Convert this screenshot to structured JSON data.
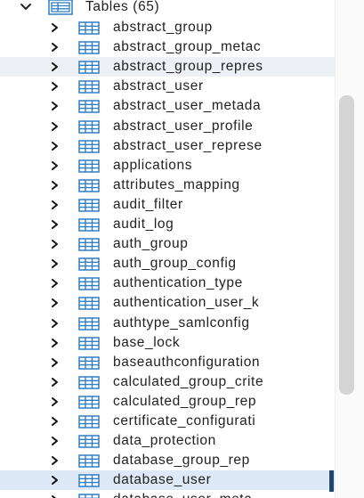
{
  "group": {
    "label": "Tables (65)",
    "expanded": true
  },
  "tables": [
    "abstract_group",
    "abstract_group_metac",
    "abstract_group_repres",
    "abstract_user",
    "abstract_user_metada",
    "abstract_user_profile",
    "abstract_user_represe",
    "applications",
    "attributes_mapping",
    "audit_filter",
    "audit_log",
    "auth_group",
    "auth_group_config",
    "authentication_type",
    "authentication_user_k",
    "authtype_samlconfig",
    "base_lock",
    "baseauthconfiguration",
    "calculated_group_crite",
    "calculated_group_rep",
    "certificate_configurati",
    "data_protection",
    "database_group_rep",
    "database_user",
    "database_user_meta"
  ],
  "hovered_index": 2,
  "selected_index": 23,
  "colors": {
    "icon": "#2f7fc6",
    "hover": "#edf0f5",
    "selected": "#dde9f6",
    "selection_bar": "#20466b",
    "text": "#222222"
  }
}
